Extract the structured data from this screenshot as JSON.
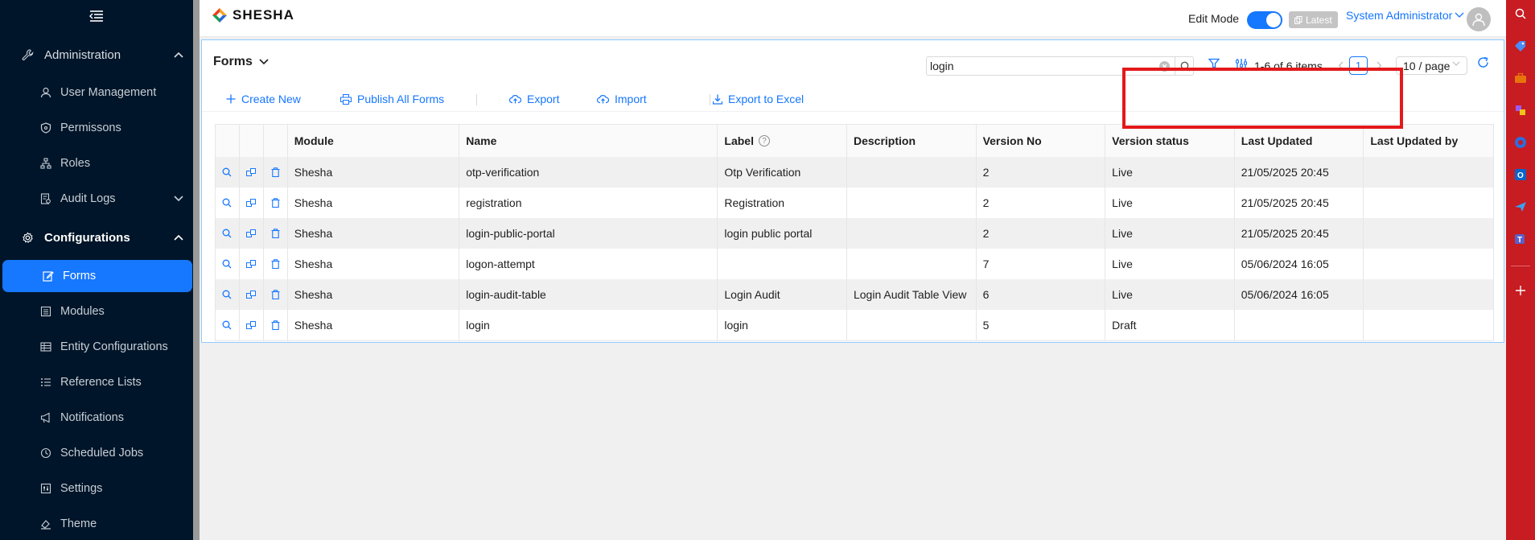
{
  "sidebar": {
    "groups": [
      {
        "label": "Administration",
        "icon": "wrench-icon",
        "expanded": true
      },
      {
        "label": "Configurations",
        "icon": "gear-icon",
        "expanded": true
      }
    ],
    "admin_items": [
      {
        "label": "User Management",
        "icon": "user-icon"
      },
      {
        "label": "Permissons",
        "icon": "shield-icon"
      },
      {
        "label": "Roles",
        "icon": "hierarchy-icon"
      },
      {
        "label": "Audit Logs",
        "icon": "audit-icon"
      }
    ],
    "config_items": [
      {
        "label": "Forms",
        "icon": "form-edit-icon",
        "selected": true
      },
      {
        "label": "Modules",
        "icon": "modules-icon"
      },
      {
        "label": "Entity Configurations",
        "icon": "table-icon"
      },
      {
        "label": "Reference Lists",
        "icon": "list-icon"
      },
      {
        "label": "Notifications",
        "icon": "megaphone-icon"
      },
      {
        "label": "Scheduled Jobs",
        "icon": "clock-icon"
      },
      {
        "label": "Settings",
        "icon": "settings-icon"
      },
      {
        "label": "Theme",
        "icon": "theme-icon"
      }
    ]
  },
  "header": {
    "logo_text": "SHESHA",
    "edit_mode_label": "Edit Mode",
    "edit_mode_on": true,
    "latest_label": "Latest",
    "user_name": "System Administrator"
  },
  "panel": {
    "title": "Forms",
    "search_value": "login",
    "pager_text": "1-6 of 6 items",
    "current_page": "1",
    "page_size": "10 / page"
  },
  "toolbar": {
    "create_new": "Create New",
    "publish_all": "Publish All Forms",
    "export": "Export",
    "import": "Import",
    "export_excel": "Export to Excel"
  },
  "table": {
    "columns": [
      "Module",
      "Name",
      "Label",
      "Description",
      "Version No",
      "Version status",
      "Last Updated",
      "Last Updated by"
    ],
    "rows": [
      {
        "module": "Shesha",
        "name": "otp-verification",
        "label": "Otp Verification",
        "description": "",
        "version": "2",
        "status": "Live",
        "updated": "21/05/2025 20:45",
        "updated_by": ""
      },
      {
        "module": "Shesha",
        "name": "registration",
        "label": "Registration",
        "description": "",
        "version": "2",
        "status": "Live",
        "updated": "21/05/2025 20:45",
        "updated_by": ""
      },
      {
        "module": "Shesha",
        "name": "login-public-portal",
        "label": "login public portal",
        "description": "",
        "version": "2",
        "status": "Live",
        "updated": "21/05/2025 20:45",
        "updated_by": ""
      },
      {
        "module": "Shesha",
        "name": "logon-attempt",
        "label": "",
        "description": "",
        "version": "7",
        "status": "Live",
        "updated": "05/06/2024 16:05",
        "updated_by": ""
      },
      {
        "module": "Shesha",
        "name": "login-audit-table",
        "label": "Login Audit",
        "description": "Login Audit Table View",
        "version": "6",
        "status": "Live",
        "updated": "05/06/2024 16:05",
        "updated_by": ""
      },
      {
        "module": "Shesha",
        "name": "login",
        "label": "login",
        "description": "",
        "version": "5",
        "status": "Draft",
        "updated": "",
        "updated_by": ""
      }
    ]
  },
  "colors": {
    "sidebar_bg": "#001529",
    "accent": "#1677ff",
    "highlight": "#e3191b",
    "edge_bar": "#c71c22"
  }
}
